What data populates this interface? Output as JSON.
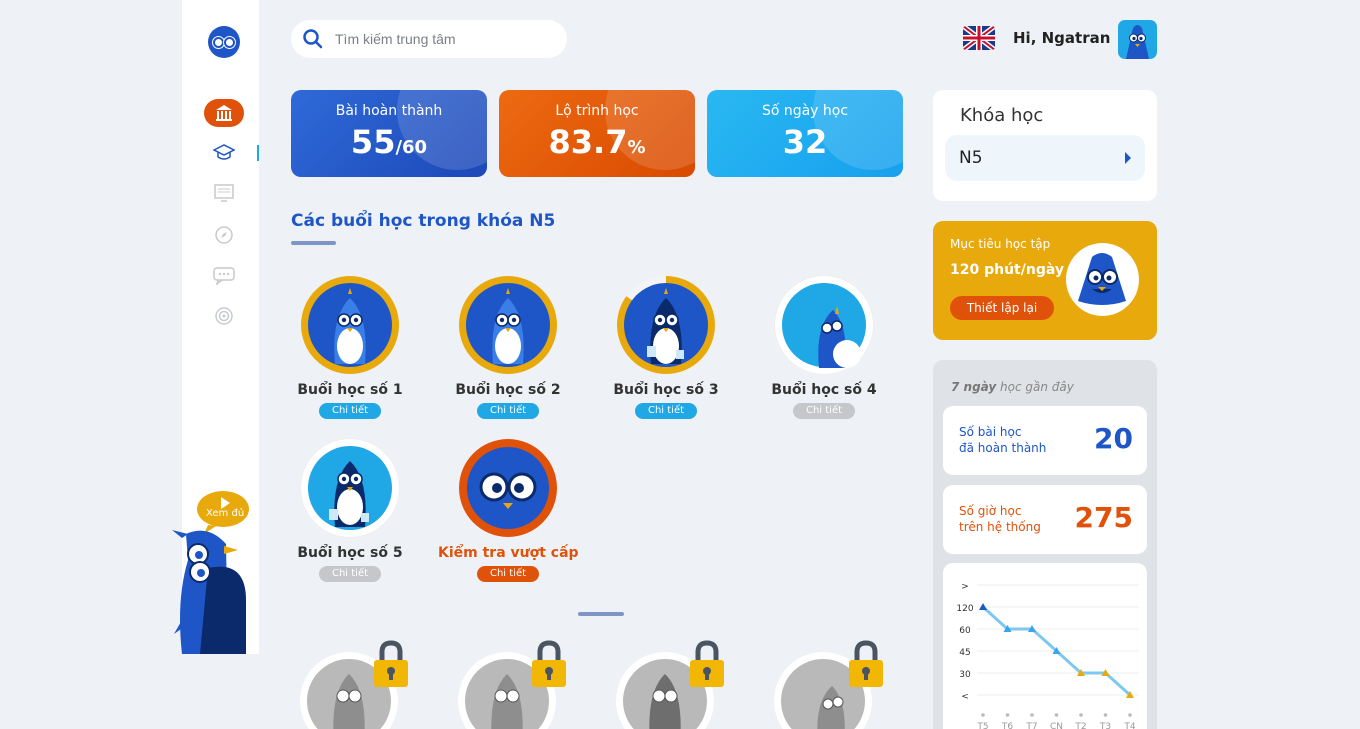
{
  "search": {
    "placeholder": "Tìm kiếm trung tâm"
  },
  "header": {
    "greeting": "Hi, Ngatran"
  },
  "sidebar": {
    "more_label": "Xem đủ"
  },
  "stats": [
    {
      "label": "Bài hoàn thành",
      "value": "55",
      "suffix": "/60"
    },
    {
      "label": "Lộ trình học",
      "value": "83.7",
      "suffix": "%"
    },
    {
      "label": "Số ngày học",
      "value": "32",
      "suffix": ""
    }
  ],
  "section": {
    "title": "Các buổi học trong khóa N5"
  },
  "lessons": [
    {
      "name": "Buổi học số 1",
      "action": "Chi tiết"
    },
    {
      "name": "Buổi học số 2",
      "action": "Chi tiết"
    },
    {
      "name": "Buổi học số 3",
      "action": "Chi tiết"
    },
    {
      "name": "Buổi học số 4",
      "action": "Chi tiết"
    },
    {
      "name": "Buổi học số 5",
      "action": "Chi tiết"
    },
    {
      "name": "Kiểm tra vượt cấp",
      "action": "Chi tiết"
    }
  ],
  "course": {
    "title": "Khóa học",
    "selected": "N5"
  },
  "goal": {
    "label": "Mục tiêu học tập",
    "value": "120 phút/ngày",
    "button": "Thiết lập lại"
  },
  "recent": {
    "head_bold": "7 ngày",
    "head_rest": " học gần đây",
    "lessons_label_1": "Số bài học",
    "lessons_label_2": "đã hoàn thành",
    "lessons_value": "20",
    "hours_label_1": "Số giờ học",
    "hours_label_2": "trên hệ thống",
    "hours_value": "275"
  },
  "chart_data": {
    "type": "line",
    "y_tick_labels": [
      ">",
      "120",
      "60",
      "45",
      "30",
      "<"
    ],
    "x": [
      "T5",
      "T6",
      "T7",
      "CN",
      "T2",
      "T3",
      "T4"
    ],
    "series": [
      {
        "values": [
          120,
          60,
          60,
          45,
          30,
          30,
          20
        ]
      }
    ]
  },
  "colors": {
    "primary": "#1e56c7",
    "accent": "#e0520a",
    "sky": "#1fa7e6",
    "gold": "#e8a90d"
  }
}
